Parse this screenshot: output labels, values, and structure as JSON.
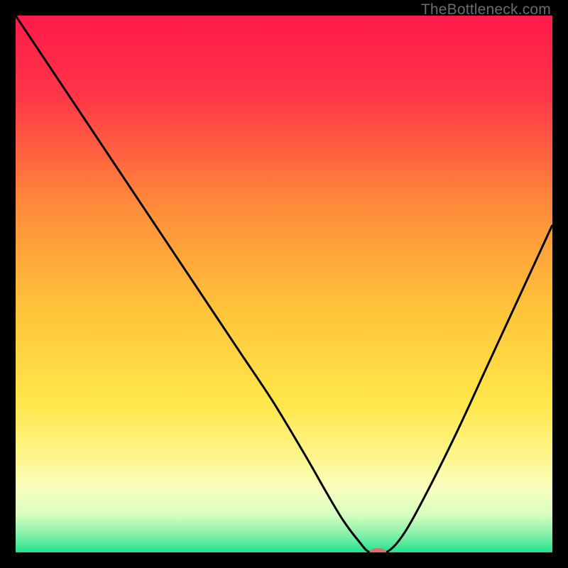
{
  "watermark": "TheBottleneck.com",
  "chart_data": {
    "type": "line",
    "title": "",
    "xlabel": "",
    "ylabel": "",
    "xlim": [
      0,
      100
    ],
    "ylim": [
      0,
      100
    ],
    "grid": false,
    "legend": false,
    "background_gradient": {
      "stops": [
        {
          "offset": 0.0,
          "color": "#ff1a4a"
        },
        {
          "offset": 0.15,
          "color": "#ff3647"
        },
        {
          "offset": 0.35,
          "color": "#ff8a3a"
        },
        {
          "offset": 0.55,
          "color": "#ffc43a"
        },
        {
          "offset": 0.72,
          "color": "#ffe74a"
        },
        {
          "offset": 0.82,
          "color": "#fdf58a"
        },
        {
          "offset": 0.88,
          "color": "#faffc0"
        },
        {
          "offset": 0.93,
          "color": "#d6ffbf"
        },
        {
          "offset": 0.97,
          "color": "#7df0a8"
        },
        {
          "offset": 1.0,
          "color": "#22e08f"
        }
      ]
    },
    "series": [
      {
        "name": "bottleneck-curve",
        "color": "#000000",
        "x": [
          0,
          6,
          12,
          18,
          24,
          30,
          36,
          42,
          48,
          54,
          58,
          61,
          64,
          66,
          69,
          72,
          76,
          82,
          88,
          94,
          100
        ],
        "y": [
          100,
          91,
          82,
          73,
          64,
          55,
          46,
          37,
          28,
          18,
          11,
          6,
          2,
          0,
          0,
          3,
          10,
          22,
          35,
          48,
          61
        ]
      }
    ],
    "marker": {
      "name": "optimal-marker",
      "x": 67.5,
      "y": 0,
      "color": "#e26a6a",
      "rx": 12,
      "ry": 6
    }
  }
}
